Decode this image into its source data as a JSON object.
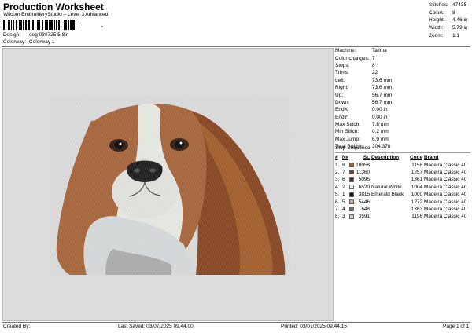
{
  "header": {
    "title": "Production Worksheet",
    "subtitle": "Wilcom EmbroideryStudio – Level 3 Advanced",
    "barcode_suffix": ",",
    "design_label": "Design:",
    "design_value": "dog 030725 5,8in",
    "colorway_label": "Colorway:",
    "colorway_value": "Colorway 1"
  },
  "summary": [
    {
      "label": "Stitches:",
      "value": "47435"
    },
    {
      "label": "Colors:",
      "value": "8"
    },
    {
      "label": "Height:",
      "value": "4.46 in"
    },
    {
      "label": "Width:",
      "value": "5.79 in"
    },
    {
      "label": "Zoom:",
      "value": "1:1"
    }
  ],
  "machine_info": [
    {
      "label": "Machine:",
      "value": "Tajima"
    },
    {
      "label": "Color changes:",
      "value": "7"
    },
    {
      "label": "Stops:",
      "value": "8"
    },
    {
      "label": "Trims:",
      "value": "22"
    },
    {
      "label": "Left:",
      "value": "73.6 mm"
    },
    {
      "label": "Right:",
      "value": "73.6 mm"
    },
    {
      "label": "Up:",
      "value": "56.7 mm"
    },
    {
      "label": "Down:",
      "value": "56.7 mm"
    },
    {
      "label": "EndX:",
      "value": "0.00 in"
    },
    {
      "label": "EndY:",
      "value": "0.00 in"
    },
    {
      "label": "Max Stitch:",
      "value": "7.8 mm"
    },
    {
      "label": "Min Stitch:",
      "value": "0.2 mm"
    },
    {
      "label": "Max Jump:",
      "value": "6.9 mm"
    },
    {
      "label": "Total Bobbin:",
      "value": "304.37ft"
    }
  ],
  "stop_sequence": {
    "title": "Stop Sequence:",
    "columns": [
      "#",
      "N#",
      "St.",
      "Description",
      "Code",
      "Brand"
    ],
    "rows": [
      {
        "idx": "1.",
        "num": "8",
        "color": "#a0603a",
        "st": "10958",
        "desc": "",
        "code": "1158",
        "brand": "Madeira Classic 40"
      },
      {
        "idx": "2.",
        "num": "7",
        "color": "#7a3b22",
        "st": "11360",
        "desc": "",
        "code": "1257",
        "brand": "Madeira Classic 40"
      },
      {
        "idx": "3.",
        "num": "6",
        "color": "#4e2b1c",
        "st": "5095",
        "desc": "",
        "code": "1361",
        "brand": "Madeira Classic 40"
      },
      {
        "idx": "4.",
        "num": "2",
        "color": "#f2f2ee",
        "st": "6520",
        "desc": "Natural White",
        "code": "1004",
        "brand": "Madeira Classic 40"
      },
      {
        "idx": "5.",
        "num": "1",
        "color": "#111111",
        "st": "3815",
        "desc": "Emerald Black",
        "code": "1000",
        "brand": "Madeira Classic 40"
      },
      {
        "idx": "6.",
        "num": "5",
        "color": "#d6a98a",
        "st": "5446",
        "desc": "",
        "code": "1272",
        "brand": "Madeira Classic 40"
      },
      {
        "idx": "7.",
        "num": "4",
        "color": "#6f6f6f",
        "st": "648",
        "desc": "",
        "code": "1363",
        "brand": "Madeira Classic 40"
      },
      {
        "idx": "8.",
        "num": "3",
        "color": "#c8ccd0",
        "st": "3591",
        "desc": "",
        "code": "1198",
        "brand": "Madeira Classic 40"
      }
    ]
  },
  "footer": {
    "created": "Created By:",
    "saved": "Last Saved: 03/07/2025 09.44.00",
    "printed": "Printed: 03/07/2025 09.44.15",
    "page": "Page 1 of 1"
  }
}
